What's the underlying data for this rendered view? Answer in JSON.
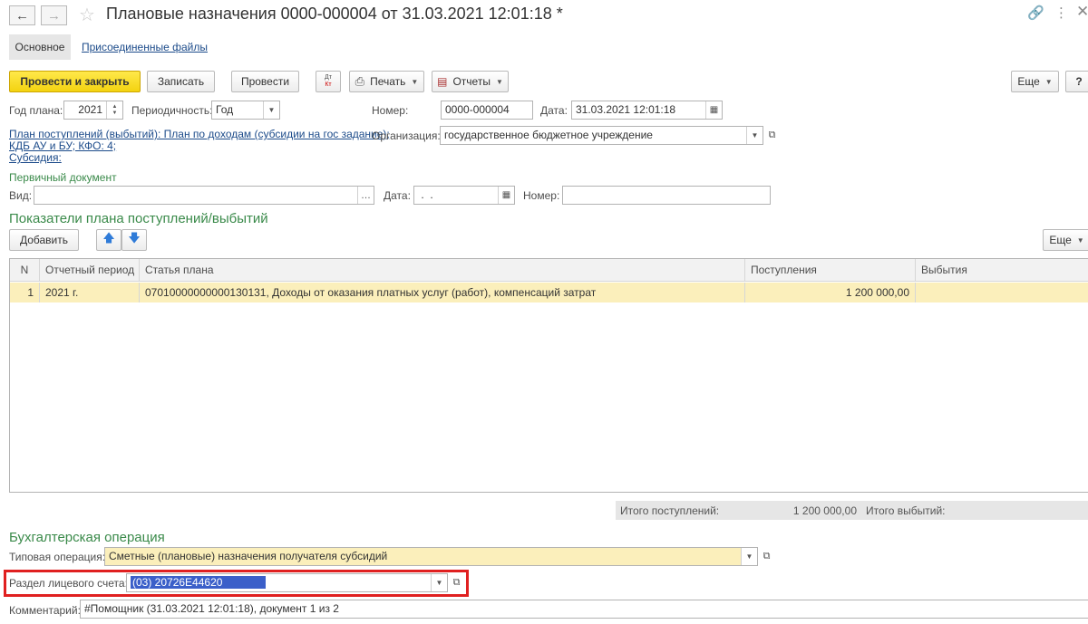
{
  "window": {
    "title": "Плановые назначения 0000-000004 от 31.03.2021 12:01:18 *",
    "tabs": [
      "Основное",
      "Присоединенные файлы"
    ]
  },
  "toolbar": {
    "post_close": "Провести и закрыть",
    "save": "Записать",
    "post": "Провести",
    "dt_kt_top": "Дт",
    "dt_kt_bottom": "Кт",
    "print": "Печать",
    "reports": "Отчеты",
    "more": "Еще",
    "help": "?"
  },
  "header": {
    "year_label": "Год плана:",
    "year_value": "2021",
    "period_label": "Периодичность:",
    "period_value": "Год",
    "number_label": "Номер:",
    "number_value": "0000-000004",
    "date_label": "Дата:",
    "date_value": "31.03.2021 12:01:18",
    "org_label": "Организация:",
    "org_value": "государственное бюджетное учреждение",
    "plan_link": "План поступлений (выбытий): План по доходам (субсидии на гос задание);",
    "kdb_link": "КДБ АУ и БУ; КФО: 4;",
    "subsidy_link": "Субсидия:"
  },
  "primary_doc": {
    "title": "Первичный документ",
    "type_label": "Вид:",
    "type_value": "",
    "date_label": "Дата:",
    "date_value": " .  .",
    "number_label": "Номер:",
    "number_value": ""
  },
  "indicators": {
    "title": "Показатели плана поступлений/выбытий",
    "add_button": "Добавить",
    "more": "Еще",
    "columns": [
      "N",
      "Отчетный период",
      "Статья плана",
      "Поступления",
      "Выбытия"
    ],
    "rows": [
      {
        "n": "1",
        "period": "2021 г.",
        "article": "07010000000000130131, Доходы от оказания платных услуг (работ), компенсаций затрат",
        "income": "1 200 000,00",
        "expense": ""
      }
    ],
    "total_income_label": "Итого поступлений:",
    "total_income_value": "1 200 000,00",
    "total_expense_label": "Итого выбытий:"
  },
  "accounting": {
    "title": "Бухгалтерская операция",
    "op_label": "Типовая операция:",
    "op_value": "Сметные (плановые) назначения получателя субсидий",
    "account_label": "Раздел лицевого счета:",
    "account_value": "(03) 20726Е44620",
    "comment_label": "Комментарий:",
    "comment_value": "#Помощник (31.03.2021 12:01:18), документ 1 из 2"
  },
  "colors": {
    "primary_button": "#f3d310",
    "section_title": "#3a8a4a",
    "link": "#1c4b8a",
    "selected_row": "#fbefbb",
    "highlight_border": "#e02020",
    "selection": "#3b5fc9"
  }
}
